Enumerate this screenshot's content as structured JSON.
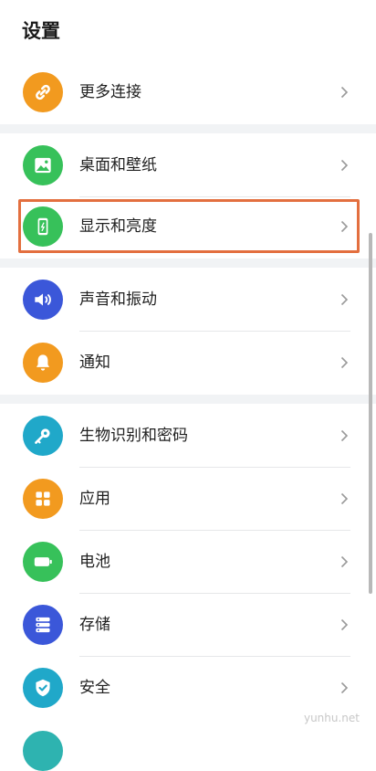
{
  "header": {
    "title": "设置"
  },
  "items": [
    {
      "label": "更多连接",
      "icon": "link-icon",
      "color": "#f29a1f"
    },
    {
      "label": "桌面和壁纸",
      "icon": "wallpaper-icon",
      "color": "#37c15a"
    },
    {
      "label": "显示和亮度",
      "icon": "display-brightness-icon",
      "color": "#37c15a"
    },
    {
      "label": "声音和振动",
      "icon": "speaker-icon",
      "color": "#3b57d9"
    },
    {
      "label": "通知",
      "icon": "bell-icon",
      "color": "#f29a1f"
    },
    {
      "label": "生物识别和密码",
      "icon": "key-icon",
      "color": "#20a8c9"
    },
    {
      "label": "应用",
      "icon": "apps-grid-icon",
      "color": "#f29a1f"
    },
    {
      "label": "电池",
      "icon": "battery-icon",
      "color": "#37c15a"
    },
    {
      "label": "存储",
      "icon": "storage-icon",
      "color": "#3b57d9"
    },
    {
      "label": "安全",
      "icon": "shield-check-icon",
      "color": "#20a8c9"
    }
  ],
  "watermark": "yunhu.net",
  "highlight_color": "#e36f3f"
}
